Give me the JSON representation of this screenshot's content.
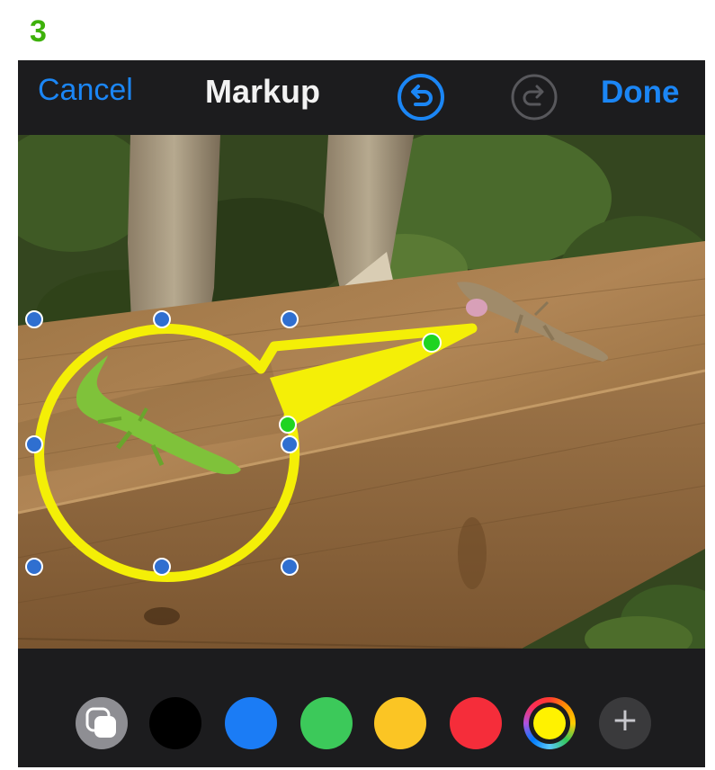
{
  "step_label": "3",
  "nav": {
    "cancel": "Cancel",
    "title": "Markup",
    "done": "Done",
    "undo_icon": "undo-arrow-icon",
    "redo_icon": "redo-arrow-icon"
  },
  "colors": {
    "accent": "#1b86f5",
    "annotation": "#f4ef07",
    "handle": "#2f6fd0",
    "tail_handle": "#1fd421",
    "step_green": "#3db10a"
  },
  "palette": [
    {
      "name": "shape-style-swatch",
      "color": "#8e8e93"
    },
    {
      "name": "black-swatch",
      "color": "#000000"
    },
    {
      "name": "blue-swatch",
      "color": "#1b7cf5"
    },
    {
      "name": "green-swatch",
      "color": "#3cc95a"
    },
    {
      "name": "yellow-swatch",
      "color": "#fbc524"
    },
    {
      "name": "red-swatch",
      "color": "#f52d3a"
    },
    {
      "name": "color-picker-swatch",
      "color": "#fff200"
    },
    {
      "name": "add-button",
      "color": "#3a3a3c"
    }
  ],
  "add_symbol": "+"
}
